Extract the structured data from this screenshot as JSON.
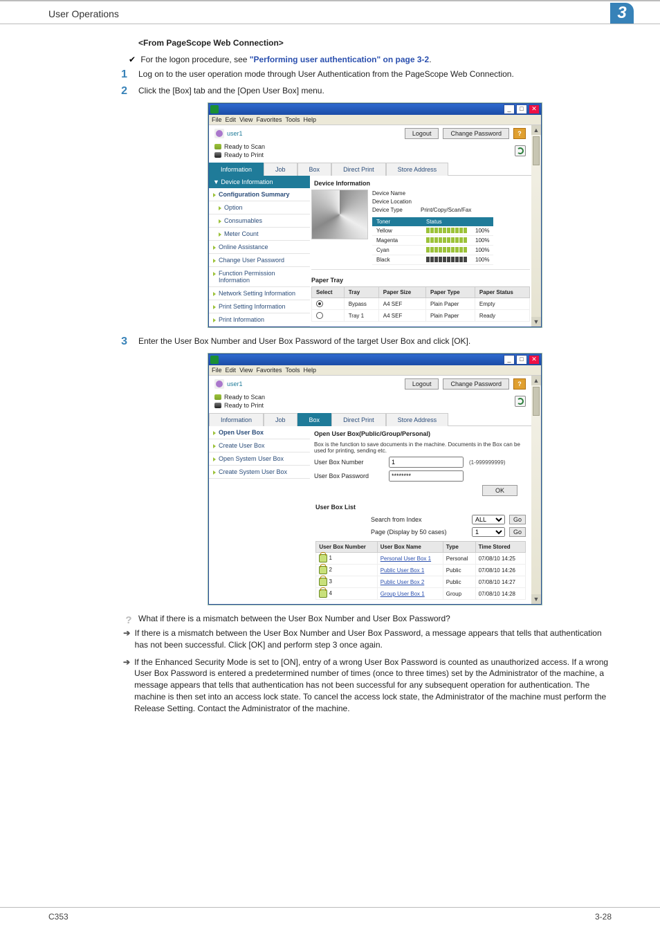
{
  "header": {
    "title": "User Operations",
    "chapter": "3"
  },
  "section": {
    "heading": "<From PageScope Web Connection>"
  },
  "checkline": {
    "lead": "For the logon procedure, see ",
    "link": "\"Performing user authentication\" on page 3-2",
    "tail": "."
  },
  "steps": {
    "s1": {
      "num": "1",
      "txt": "Log on to the user operation mode through User Authentication from the PageScope Web Connection."
    },
    "s2": {
      "num": "2",
      "txt": "Click the [Box] tab and the [Open User Box] menu."
    },
    "s3": {
      "num": "3",
      "txt": "Enter the User Box Number and User Box Password of the target User Box and click [OK]."
    }
  },
  "browser_menu": {
    "file": "File",
    "edit": "Edit",
    "view": "View",
    "favorites": "Favorites",
    "tools": "Tools",
    "help": "Help"
  },
  "psw": {
    "user": "user1",
    "logout": "Logout",
    "chpass": "Change Password",
    "ready_scan": "Ready to Scan",
    "ready_print": "Ready to Print",
    "tabs": {
      "info": "Information",
      "job": "Job",
      "box": "Box",
      "direct": "Direct Print",
      "store": "Store Address"
    }
  },
  "shot1": {
    "dev_info_hdr": "Device Information",
    "side": {
      "config": "Configuration Summary",
      "option": "Option",
      "consumables": "Consumables",
      "meter": "Meter Count",
      "online": "Online Assistance",
      "chpass": "Change User Password",
      "funcperm": "Function Permission Information",
      "netset": "Network Setting Information",
      "printset": "Print Setting Information",
      "printinfo": "Print Information"
    },
    "title": "Device Information",
    "kv": {
      "dev_name": "Device Name",
      "dev_loc": "Device Location",
      "dev_type_lbl": "Device Type",
      "dev_type": "Print/Copy/Scan/Fax"
    },
    "toner": {
      "hdr_toner": "Toner",
      "hdr_status": "Status",
      "yellow": "Yellow",
      "magenta": "Magenta",
      "cyan": "Cyan",
      "black": "Black",
      "pct": "100%"
    },
    "paper_hdr": "Paper Tray",
    "tray_tbl": {
      "select": "Select",
      "tray": "Tray",
      "size": "Paper Size",
      "ptype": "Paper Type",
      "pstatus": "Paper Status"
    },
    "trays": [
      {
        "sel_on": true,
        "tray": "Bypass",
        "size": "A4 SEF",
        "ptype": "Plain Paper",
        "status": "Empty"
      },
      {
        "sel_on": false,
        "tray": "Tray 1",
        "size": "A4 SEF",
        "ptype": "Plain Paper",
        "status": "Ready"
      }
    ]
  },
  "shot2": {
    "side": {
      "open": "Open User Box",
      "create": "Create User Box",
      "opensys": "Open System User Box",
      "createsys": "Create System User Box"
    },
    "title": "Open User Box(Public/Group/Personal)",
    "desc": "Box is the function to save documents in the machine.\nDocuments in the Box can be used for printing, sending etc.",
    "num_lbl": "User Box Number",
    "num_val": "1",
    "num_hint": "(1-999999999)",
    "pwd_lbl": "User Box Password",
    "pwd_val": "********",
    "ok": "OK",
    "list_hdr": "User Box List",
    "search_lbl": "Search from Index",
    "page_lbl": "Page (Display by 50 cases)",
    "sel_all": "ALL",
    "sel_page": "1",
    "go": "Go",
    "tbl": {
      "num": "User Box Number",
      "name": "User Box Name",
      "type": "Type",
      "stored": "Time Stored"
    },
    "rows": [
      {
        "num": "1",
        "name": "Personal User Box 1",
        "type": "Personal",
        "stored": "07/08/10 14:25"
      },
      {
        "num": "2",
        "name": "Public User Box 1",
        "type": "Public",
        "stored": "07/08/10 14:26"
      },
      {
        "num": "3",
        "name": "Public User Box 2",
        "type": "Public",
        "stored": "07/08/10 14:27"
      },
      {
        "num": "4",
        "name": "Group User Box 1",
        "type": "Group",
        "stored": "07/08/10 14:28"
      }
    ]
  },
  "qa": {
    "q": "What if there is a mismatch between the User Box Number and User Box Password?",
    "a1": "If there is a mismatch between the User Box Number and User Box Password, a message appears that tells that authentication has not been successful. Click [OK] and perform step 3 once again.",
    "a2": "If the Enhanced Security Mode is set to [ON], entry of a wrong User Box Password is counted as unauthorized access. If a wrong User Box Password is entered a predetermined number of times (once to three times) set by the Administrator of the machine, a message appears that tells that authentication has not been successful for any subsequent operation for authentication. The machine is then set into an access lock state. To cancel the access lock state, the Administrator of the machine must perform the Release Setting. Contact the Administrator of the machine."
  },
  "footer": {
    "left": "C353",
    "right": "3-28"
  }
}
